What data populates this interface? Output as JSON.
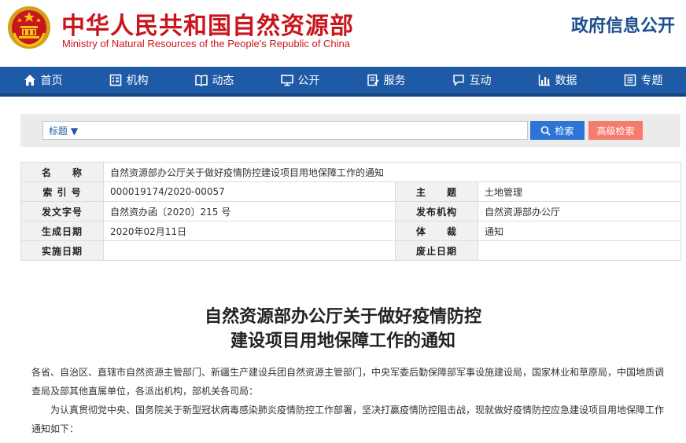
{
  "header": {
    "ministry_cn": "中华人民共和国自然资源部",
    "ministry_en": "Ministry of Natural Resources of the People's Republic of China",
    "site_title": "政府信息公开"
  },
  "nav": [
    {
      "label": "首页",
      "icon": "home-icon"
    },
    {
      "label": "机构",
      "icon": "org-icon"
    },
    {
      "label": "动态",
      "icon": "book-icon"
    },
    {
      "label": "公开",
      "icon": "monitor-icon"
    },
    {
      "label": "服务",
      "icon": "form-icon"
    },
    {
      "label": "互动",
      "icon": "chat-icon"
    },
    {
      "label": "数据",
      "icon": "bar-chart-icon"
    },
    {
      "label": "专题",
      "icon": "folder-icon"
    }
  ],
  "search": {
    "selected": "标题 ▼",
    "placeholder": "",
    "search_label": "检索",
    "advanced_label": "高级检索"
  },
  "info": {
    "name_label": "名　　称",
    "name_value": "自然资源部办公厅关于做好疫情防控建设项目用地保障工作的通知",
    "index_label": "索 引 号",
    "index_value": "000019174/2020-00057",
    "topic_label": "主　　题",
    "topic_value": "土地管理",
    "docno_label": "发文字号",
    "docno_value": "自然资办函〔2020〕215 号",
    "issuer_label": "发布机构",
    "issuer_value": "自然资源部办公厅",
    "date_label": "生成日期",
    "date_value": "2020年02月11日",
    "genre_label": "体　　裁",
    "genre_value": "通知",
    "effective_label": "实施日期",
    "effective_value": "",
    "repeal_label": "废止日期",
    "repeal_value": ""
  },
  "article": {
    "title_line1": "自然资源部办公厅关于做好疫情防控",
    "title_line2": "建设项目用地保障工作的通知",
    "para1": "各省、自治区、直辖市自然资源主管部门、新疆生产建设兵团自然资源主管部门，中央军委后勤保障部军事设施建设局，国家林业和草原局，中国地质调查局及部其他直属单位，各派出机构，部机关各司局：",
    "para2": "为认真贯彻党中央、国务院关于新型冠状病毒感染肺炎疫情防控工作部署，坚决打赢疫情防控阻击战，现就做好疫情防控应急建设项目用地保障工作通知如下："
  },
  "colors": {
    "brand_red": "#c8161d",
    "nav_blue": "#1e5aa6",
    "search_blue": "#2d74d6",
    "advanced_coral": "#f47b6d"
  }
}
